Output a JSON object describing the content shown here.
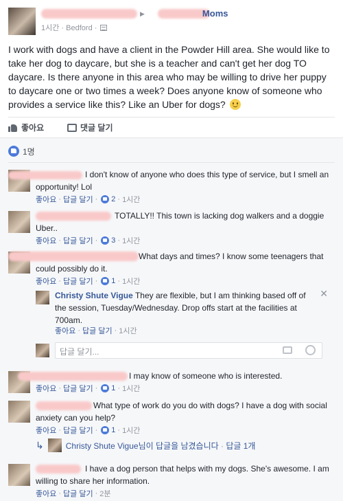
{
  "post": {
    "group_name": "Moms",
    "time": "1시간",
    "location": "Bedford",
    "body": "I work with dogs and have a client in the Powder Hill area. She would like to take her dog to daycare, but she is a teacher and can't get her dog TO daycare. Is there anyone in this area who may be willing to drive her puppy to daycare one or two times a week? Does anyone know of someone who provides a service like this? Like an Uber for dogs?",
    "like_label": "좋아요",
    "comment_label": "댓글 달기",
    "likes_count": "1명"
  },
  "ui": {
    "like": "좋아요",
    "reply": "답글 달기",
    "dot": "·",
    "reply_placeholder": "답글 달기..."
  },
  "comments": [
    {
      "text": "I don't know of anyone who does this type of service, but I smell an opportunity! Lol",
      "likes": "2",
      "time": "1시간"
    },
    {
      "text": "TOTALLY!! This town is lacking dog walkers and a doggie Uber..",
      "likes": "3",
      "time": "1시간"
    },
    {
      "text": "What days and times? I know some teenagers that could possibly do it.",
      "likes": "1",
      "time": "1시간",
      "reply": {
        "name": "Christy Shute Vigue",
        "text": "They are flexible, but I am thinking based off of the session, Tuesday/Wednesday. Drop offs start at the facilities at 700am.",
        "time": "1시간"
      }
    },
    {
      "text": "I may know of someone who is interested.",
      "likes": "1",
      "time": "1시간"
    },
    {
      "text": "What type of work do you do with dogs? I have a dog with social anxiety can you help?",
      "likes": "1",
      "time": "1시간",
      "replies_summary": {
        "name": "Christy Shute Vigue",
        "text": "님이 답글을 남겼습니다",
        "count": "답글 1개"
      }
    },
    {
      "text": "I have a dog person that helps with my dogs. She's awesome. I am willing to share her information.",
      "time": "2분"
    }
  ]
}
